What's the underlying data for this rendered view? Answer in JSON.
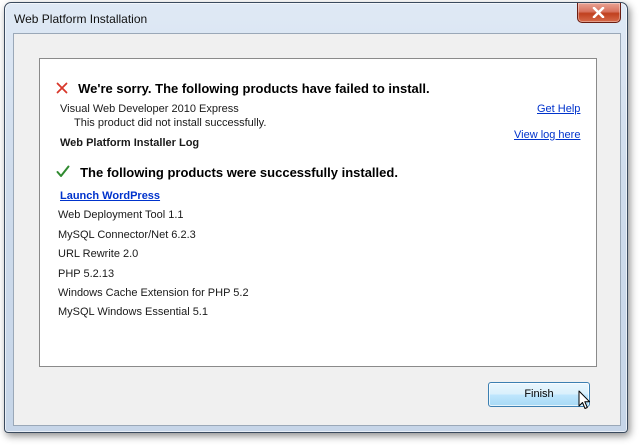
{
  "window": {
    "title": "Web Platform Installation"
  },
  "failed": {
    "heading": "We're sorry. The following products have failed to install.",
    "product_name": "Visual Web Developer 2010 Express",
    "product_message": "This product did not install successfully.",
    "log_label": "Web Platform Installer Log",
    "get_help_link": "Get Help",
    "view_log_link": "View log here"
  },
  "success": {
    "heading": "The following products were successfully installed.",
    "launch_link": "Launch WordPress",
    "products": [
      "Web Deployment Tool 1.1",
      "MySQL Connector/Net 6.2.3",
      "URL Rewrite 2.0",
      "PHP 5.2.13",
      "Windows Cache Extension for PHP 5.2",
      "MySQL Windows Essential 5.1"
    ]
  },
  "buttons": {
    "finish_label": "Finish"
  },
  "icons": {
    "close": "close-icon",
    "error": "error-x-icon",
    "success": "checkmark-icon",
    "cursor": "mouse-pointer-icon"
  },
  "colors": {
    "error_red": "#d8372a",
    "success_green": "#2f8a2f",
    "link_blue": "#0033cc"
  }
}
